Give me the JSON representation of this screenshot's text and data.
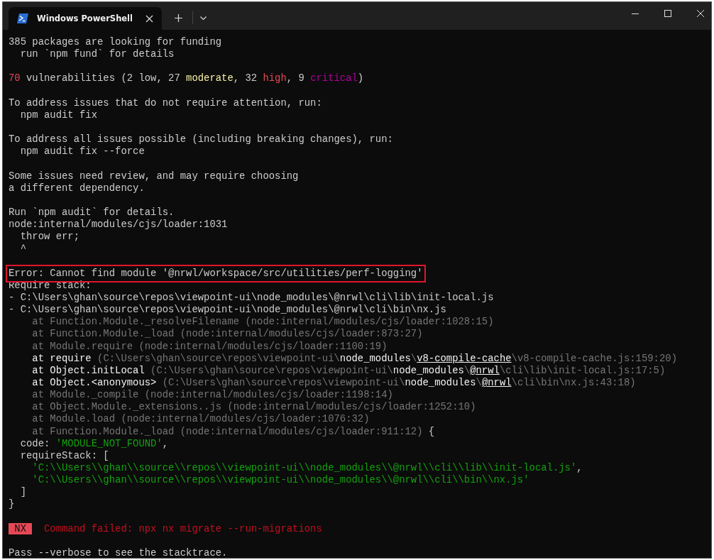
{
  "window": {
    "tab": {
      "title": "Windows PowerShell",
      "selected": true
    }
  },
  "lines": [
    [
      {
        "text": "385 packages are looking for funding",
        "kind": "n"
      }
    ],
    [
      {
        "text": "  run `npm fund` for details",
        "kind": "n"
      }
    ],
    {
      "blank_before": true,
      "segments": [
        {
          "text": "70",
          "kind": "red"
        },
        {
          "text": " vulnerabilities (2 low, 27 ",
          "kind": "n"
        },
        {
          "text": "moderate",
          "kind": "yellow"
        },
        {
          "text": ", 32 ",
          "kind": "n"
        },
        {
          "text": "high",
          "kind": "red"
        },
        {
          "text": ", 9 ",
          "kind": "n"
        },
        {
          "text": "critical",
          "kind": "magenta"
        },
        {
          "text": ")",
          "kind": "n"
        }
      ]
    },
    {
      "blank_before": true,
      "segments": [
        {
          "text": "To address issues that do not require attention, run:",
          "kind": "n"
        }
      ]
    },
    [
      {
        "text": "  npm audit fix",
        "kind": "n"
      }
    ],
    {
      "blank_before": true,
      "segments": [
        {
          "text": "To address all issues possible (including breaking changes), run:",
          "kind": "n"
        }
      ]
    },
    [
      {
        "text": "  npm audit fix --force",
        "kind": "n"
      }
    ],
    {
      "blank_before": true,
      "segments": [
        {
          "text": "Some issues need review, and may require choosing",
          "kind": "n"
        }
      ]
    },
    [
      {
        "text": "a different dependency.",
        "kind": "n"
      }
    ],
    {
      "blank_before": true,
      "segments": [
        {
          "text": "Run `npm audit` for details.",
          "kind": "n"
        }
      ]
    },
    [
      {
        "text": "node:internal/modules/cjs/loader:1031",
        "kind": "n"
      }
    ],
    [
      {
        "text": "  throw err;",
        "kind": "n"
      }
    ],
    [
      {
        "text": "  ^",
        "kind": "n"
      }
    ],
    {
      "blank_before": true,
      "highlighted": true,
      "segments": [
        {
          "text": "Error: Cannot find module '@nrwl/workspace/src/utilities/perf-logging'",
          "kind": "n"
        }
      ]
    },
    [
      {
        "text": "Require stack:",
        "kind": "n"
      }
    ],
    [
      {
        "text": "- C:\\Users\\ghan\\source\\repos\\viewpoint-ui\\node_modules\\@nrwl\\cli\\lib\\init-local.js",
        "kind": "n"
      }
    ],
    [
      {
        "text": "- C:\\Users\\ghan\\source\\repos\\viewpoint-ui\\node_modules\\@nrwl\\cli\\bin\\nx.js",
        "kind": "n"
      }
    ],
    [
      {
        "text": "    at Function.Module._resolveFilename (node:internal/modules/cjs/loader:1028:15)",
        "kind": "dim"
      }
    ],
    [
      {
        "text": "    at Function.Module._load (node:internal/modules/cjs/loader:873:27)",
        "kind": "dim"
      }
    ],
    [
      {
        "text": "    at Module.require (node:internal/modules/cjs/loader:1100:19)",
        "kind": "dim"
      }
    ],
    [
      {
        "text": "    at require ",
        "kind": "white"
      },
      {
        "text": "(C:\\Users\\ghan\\source\\repos\\viewpoint-ui\\",
        "kind": "dim"
      },
      {
        "text": "node_modules",
        "kind": "white"
      },
      {
        "text": "\\",
        "kind": "dim"
      },
      {
        "text": "v8-compile-cache",
        "kind": "link"
      },
      {
        "text": "\\v8-compile-cache.js:159:20)",
        "kind": "dim"
      }
    ],
    [
      {
        "text": "    at Object.initLocal ",
        "kind": "white"
      },
      {
        "text": "(C:\\Users\\ghan\\source\\repos\\viewpoint-ui\\",
        "kind": "dim"
      },
      {
        "text": "node_modules",
        "kind": "white"
      },
      {
        "text": "\\",
        "kind": "dim"
      },
      {
        "text": "@nrwl",
        "kind": "link"
      },
      {
        "text": "\\cli\\lib\\init-local.js:17:5)",
        "kind": "dim"
      }
    ],
    [
      {
        "text": "    at Object.<anonymous> ",
        "kind": "white"
      },
      {
        "text": "(C:\\Users\\ghan\\source\\repos\\viewpoint-ui\\",
        "kind": "dim"
      },
      {
        "text": "node_modules",
        "kind": "white"
      },
      {
        "text": "\\",
        "kind": "dim"
      },
      {
        "text": "@nrwl",
        "kind": "link"
      },
      {
        "text": "\\cli\\bin\\nx.js:43:18)",
        "kind": "dim"
      }
    ],
    [
      {
        "text": "    at Module._compile (node:internal/modules/cjs/loader:1198:14)",
        "kind": "dim"
      }
    ],
    [
      {
        "text": "    at Object.Module._extensions..js (node:internal/modules/cjs/loader:1252:10)",
        "kind": "dim"
      }
    ],
    [
      {
        "text": "    at Module.load (node:internal/modules/cjs/loader:1076:32)",
        "kind": "dim"
      }
    ],
    [
      {
        "text": "    at Function.Module._load (node:internal/modules/cjs/loader:911:12)",
        "kind": "dim"
      },
      {
        "text": " {",
        "kind": "n"
      }
    ],
    [
      {
        "text": "  code: ",
        "kind": "n"
      },
      {
        "text": "'MODULE_NOT_FOUND'",
        "kind": "green"
      },
      {
        "text": ",",
        "kind": "n"
      }
    ],
    [
      {
        "text": "  requireStack: [",
        "kind": "n"
      }
    ],
    [
      {
        "text": "    'C:\\\\Users\\\\ghan\\\\source\\\\repos\\\\viewpoint-ui\\\\node_modules\\\\@nrwl\\\\cli\\\\lib\\\\init-local.js'",
        "kind": "green"
      },
      {
        "text": ",",
        "kind": "n"
      }
    ],
    [
      {
        "text": "    'C:\\\\Users\\\\ghan\\\\source\\\\repos\\\\viewpoint-ui\\\\node_modules\\\\@nrwl\\\\cli\\\\bin\\\\nx.js'",
        "kind": "green"
      }
    ],
    [
      {
        "text": "  ]",
        "kind": "n"
      }
    ],
    [
      {
        "text": "}",
        "kind": "n"
      }
    ],
    {
      "blank_before": true,
      "segments": [
        {
          "text": " NX ",
          "kind": "badge"
        },
        {
          "text": "  Command failed: npx nx migrate --run-migrations",
          "kind": "error"
        }
      ]
    },
    {
      "blank_before": true,
      "segments": [
        {
          "text": "Pass --verbose to see the stacktrace.",
          "kind": "n"
        }
      ]
    }
  ]
}
